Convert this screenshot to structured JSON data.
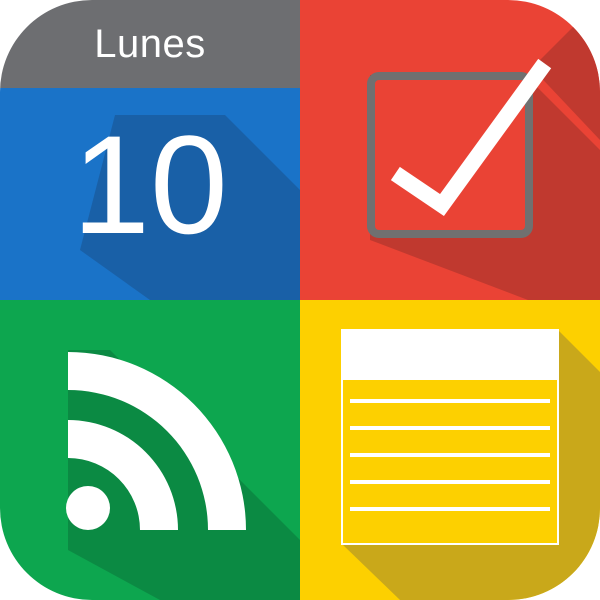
{
  "calendar": {
    "weekday": "Lunes",
    "day_number": "10"
  },
  "colors": {
    "calendar_header": "#6d6e71",
    "calendar_body": "#1a73c8",
    "tasks_bg": "#ea4335",
    "rss_bg": "#0da64f",
    "notes_bg": "#fdd000",
    "checkbox_stroke": "#707070",
    "white": "#ffffff"
  },
  "icons": [
    "calendar-icon",
    "checkbox-checked-icon",
    "rss-feed-icon",
    "notepad-icon"
  ]
}
